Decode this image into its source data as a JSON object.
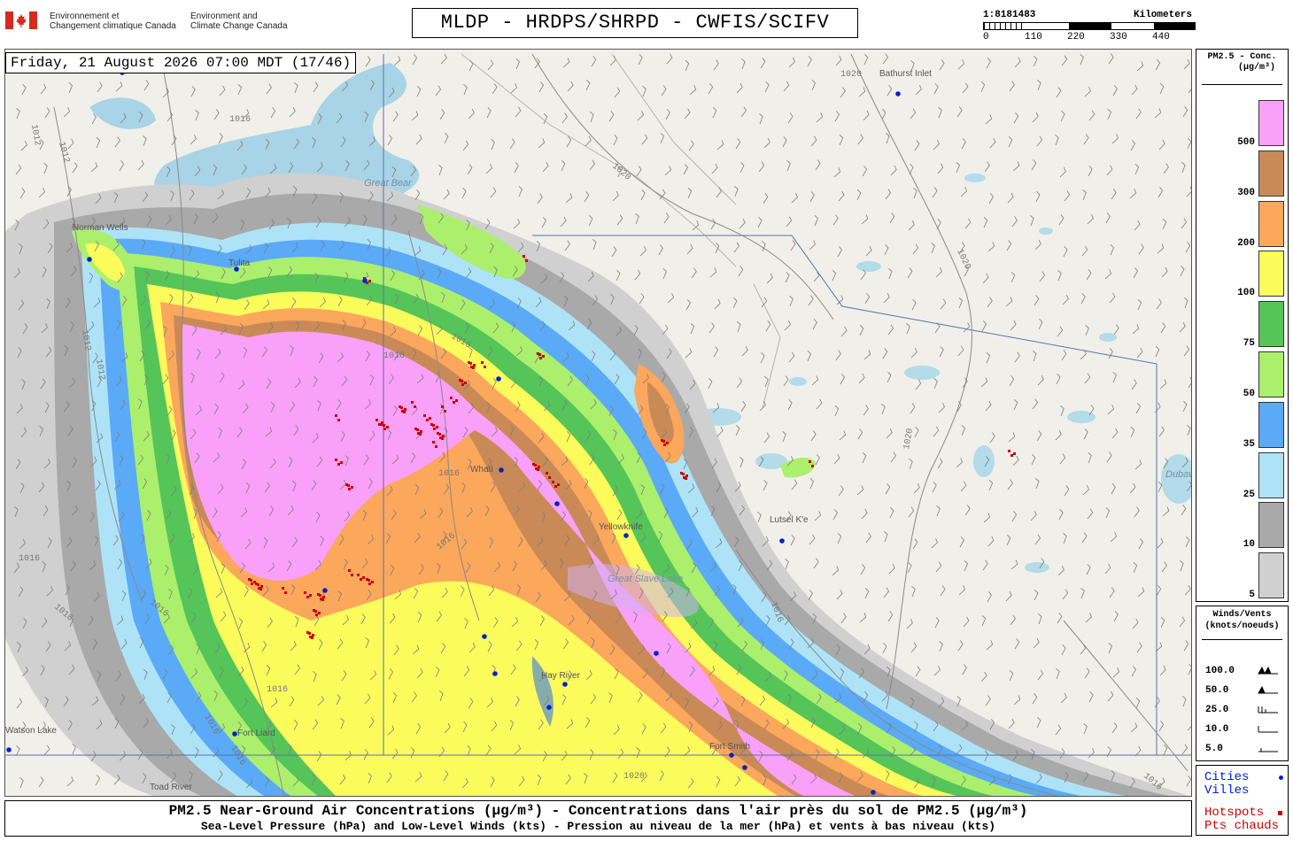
{
  "header": {
    "agency_fr": [
      "Environnement et",
      "Changement climatique Canada"
    ],
    "agency_en": [
      "Environment and",
      "Climate Change Canada"
    ],
    "title": "MLDP - HRDPS/SHRPD - CWFIS/SCIFV",
    "scale_ratio": "1:8181483",
    "scale_unit": "Kilometers",
    "scale_ticks": [
      "0",
      "110",
      "220",
      "330",
      "440"
    ]
  },
  "map": {
    "datetime": "Friday, 21 August 2026 07:00 MDT (17/46)",
    "places": [
      "Bathurst Inlet",
      "Great Bear",
      "Whatì",
      "Yellowknife",
      "Great Slave Lake",
      "Lutsel K'e",
      "Hay River",
      "Fort Liard",
      "Fort Smith",
      "Toad River",
      "Dubawnt Lake",
      "Norman Wells",
      "Watson Lake",
      "Tulita"
    ],
    "isobars": [
      "1016",
      "1012",
      "1012",
      "1012",
      "1012",
      "1016",
      "1020",
      "1020",
      "1020",
      "1020",
      "1016",
      "1016",
      "1016",
      "1016",
      "1016",
      "1016",
      "1016",
      "1016",
      "1020",
      "1016",
      "1016",
      "1016"
    ]
  },
  "legend_conc": {
    "title_line1": "PM2.5 - Conc.",
    "title_line2": "(µg/m³)",
    "levels": [
      {
        "label": "500",
        "color": "#f9a0f9"
      },
      {
        "label": "300",
        "color": "#c98a58"
      },
      {
        "label": "200",
        "color": "#fba75c"
      },
      {
        "label": "100",
        "color": "#fbfb5c"
      },
      {
        "label": "75",
        "color": "#55c55a"
      },
      {
        "label": "50",
        "color": "#abef6c"
      },
      {
        "label": "35",
        "color": "#5aaaf7"
      },
      {
        "label": "25",
        "color": "#aee3f7"
      },
      {
        "label": "10",
        "color": "#a9a9a9"
      },
      {
        "label": "5",
        "color": "#d0d0d0"
      }
    ]
  },
  "legend_wind": {
    "title_line1": "Winds/Vents",
    "title_line2": "(knots/noeuds)",
    "rows": [
      "100.0",
      "50.0",
      "25.0",
      "10.0",
      "5.0"
    ]
  },
  "legend_points": {
    "cities": "Cities",
    "villes": "Villes",
    "hotspots": "Hotspots",
    "pts_chauds": "Pts chauds",
    "city_color": "#0022cc",
    "hotspot_color": "#cc0000"
  },
  "footer": {
    "line1": "PM2.5 Near-Ground Air Concentrations (µg/m³) - Concentrations dans l'air près du sol de PM2.5 (µg/m³)",
    "line2": "Sea-Level Pressure (hPa) and Low-Level Winds (kts) - Pression au niveau de la mer (hPa) et vents à bas niveau (kts)"
  }
}
